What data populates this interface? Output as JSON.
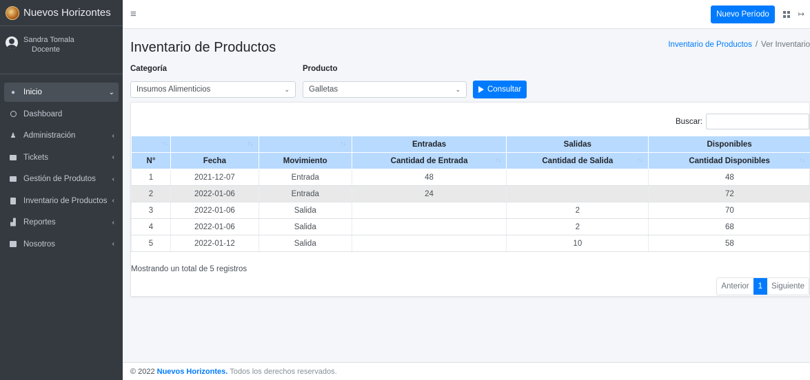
{
  "brand": {
    "title": "Nuevos Horizontes"
  },
  "user": {
    "name": "Sandra Tomala",
    "role": "Docente"
  },
  "sidebar": {
    "items": [
      {
        "label": "Inicio",
        "chevron": "⌄"
      },
      {
        "label": "Dashboard",
        "chevron": ""
      },
      {
        "label": "Administración",
        "chevron": "‹"
      },
      {
        "label": "Tickets",
        "chevron": "‹"
      },
      {
        "label": "Gestión de Produtos",
        "chevron": "‹"
      },
      {
        "label": "Inventario de Productos",
        "chevron": "‹"
      },
      {
        "label": "Reportes",
        "chevron": "‹"
      },
      {
        "label": "Nosotros",
        "chevron": "‹"
      }
    ]
  },
  "topbar": {
    "new_period_label": "Nuevo Período"
  },
  "page": {
    "title": "Inventario de Productos",
    "breadcrumb": {
      "link": "Inventario de Productos",
      "separator": "/",
      "current": "Ver Inventario"
    }
  },
  "filters": {
    "category_label": "Categoría",
    "category_value": "Insumos Alimenticios",
    "product_label": "Producto",
    "product_value": "Galletas",
    "consult_label": "Consultar"
  },
  "table": {
    "search_label": "Buscar:",
    "group_headers": [
      "",
      "",
      "",
      "Entradas",
      "Salidas",
      "Disponibles"
    ],
    "headers": [
      "N°",
      "Fecha",
      "Movimiento",
      "Cantidad de Entrada",
      "Cantidad de Salida",
      "Cantidad Disponibles"
    ],
    "rows": [
      [
        "1",
        "2021-12-07",
        "Entrada",
        "48",
        "",
        "48"
      ],
      [
        "2",
        "2022-01-06",
        "Entrada",
        "24",
        "",
        "72"
      ],
      [
        "3",
        "2022-01-06",
        "Salida",
        "",
        "2",
        "70"
      ],
      [
        "4",
        "2022-01-06",
        "Salida",
        "",
        "2",
        "68"
      ],
      [
        "5",
        "2022-01-12",
        "Salida",
        "",
        "10",
        "58"
      ]
    ],
    "info": "Mostrando un total de 5 registros",
    "pagination": {
      "prev": "Anterior",
      "current": "1",
      "next": "Siguiente"
    }
  },
  "footer": {
    "copyright": "© 2022",
    "brand": "Nuevos Horizontes.",
    "rights": "Todos los derechos reservados."
  },
  "colors": {
    "primary": "#007bff",
    "sidebar": "#343a40",
    "table_header": "#b8daff"
  }
}
